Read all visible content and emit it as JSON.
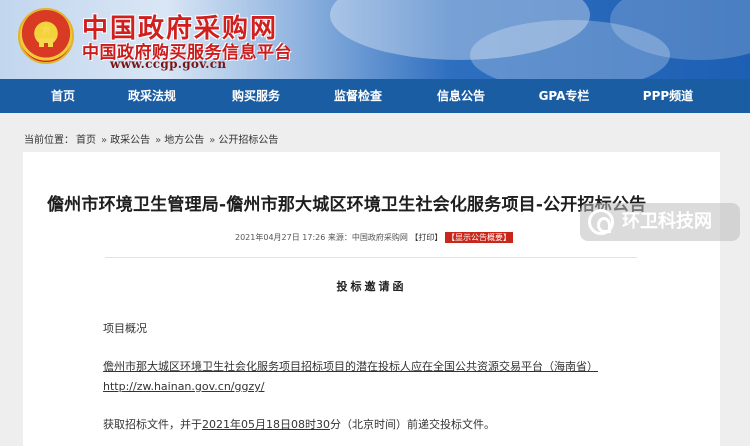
{
  "header": {
    "site_title": "中国政府采购网",
    "site_subtitle": "中国政府购买服务信息平台",
    "site_url": "www.ccgp.gov.cn",
    "emblem_icon": "national-emblem-icon"
  },
  "nav": {
    "items": [
      "首页",
      "政采法规",
      "购买服务",
      "监督检查",
      "信息公告",
      "GPA专栏",
      "PPP频道"
    ]
  },
  "breadcrumb": {
    "prefix": "当前位置：",
    "items": [
      "首页",
      "政采公告",
      "地方公告",
      "公开招标公告"
    ],
    "separator": "»"
  },
  "article": {
    "title": "儋州市环境卫生管理局-儋州市那大城区环境卫生社会化服务项目-公开招标公告",
    "meta_date": "2021年04月27日 17:26",
    "meta_source": "来源：中国政府采购网",
    "print_label": "【打印】",
    "summary_label": "【显示公告概要】",
    "section_heading": "投标邀请函",
    "para1": "项目概况",
    "para2_link": "儋州市那大城区环境卫生社会化服务项目招标项目的潜在投标人应在全国公共资源交易平台（海南省）",
    "para3_link": "http://zw.hainan.gov.cn/ggzy/",
    "para4_prefix": "获取招标文件，并于",
    "para4_date": "2021年05月18日08时30",
    "para4_suffix": "分（北京时间）前递交投标文件。"
  },
  "watermark": {
    "text": "环卫科技网",
    "icon": "leaf-logo-icon"
  },
  "colors": {
    "nav_bg": "#1a5da3",
    "title_red": "#d01f1f",
    "badge_red": "#c8281b"
  }
}
